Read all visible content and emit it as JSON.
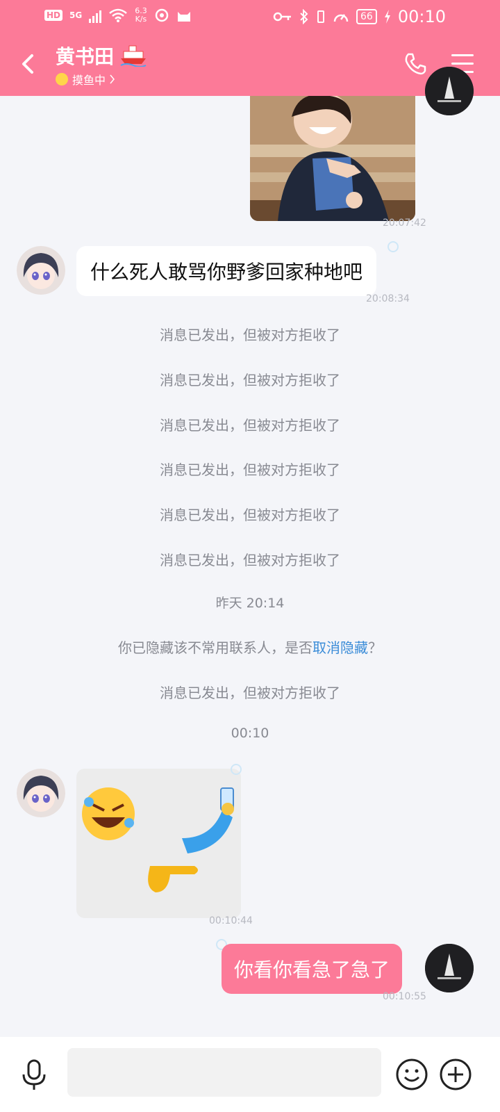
{
  "status_bar": {
    "hd": "HD",
    "net_gen": "5G",
    "speed_value": "6.3",
    "speed_unit": "K/s",
    "battery": "66",
    "time": "00:10"
  },
  "header": {
    "contact_name": "黄书田",
    "status": "摸鱼中"
  },
  "messages": {
    "ts_1": "20:07:42",
    "msg_in_1": "什么死人敢骂你野爹回家种地吧",
    "ts_2": "20:08:34",
    "rejected": "消息已发出，但被对方拒收了",
    "time_divider_1": "昨天 20:14",
    "hidden_notice_prefix": "你已隐藏该不常用联系人，是否",
    "hidden_notice_link": "取消隐藏",
    "hidden_notice_suffix": "？",
    "time_divider_2": "00:10",
    "ts_3": "00:10:44",
    "msg_out_1": "你看你看急了急了",
    "ts_4": "00:10:55"
  },
  "colors": {
    "accent": "#fc7a98",
    "link": "#3a8cd8",
    "background": "#f4f5f9"
  },
  "icons": [
    "back-icon",
    "ship-emoji-icon",
    "phone-icon",
    "menu-icon",
    "mic-icon",
    "emoji-icon",
    "plus-icon"
  ]
}
